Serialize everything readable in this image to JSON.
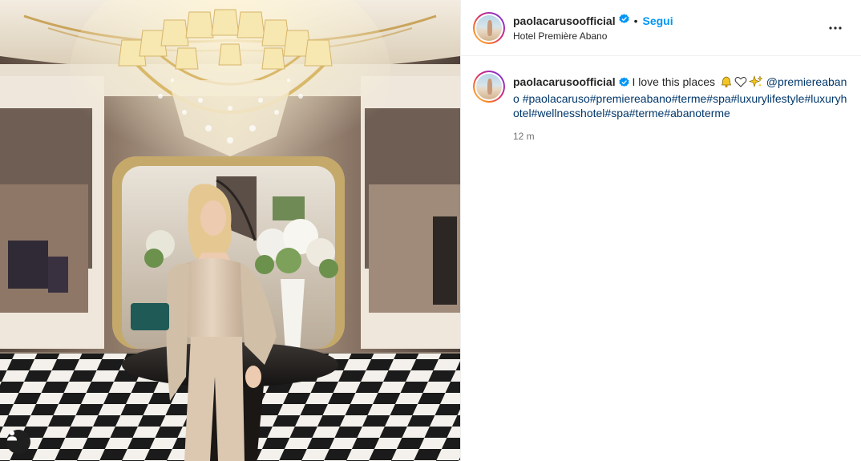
{
  "post": {
    "username": "paolacarusoofficial",
    "separator": "•",
    "follow_label": "Segui",
    "location": "Hotel Première Abano",
    "more_icon": "more-horizontal-icon"
  },
  "caption": {
    "username": "paolacarusoofficial",
    "text": "I love this places",
    "emojis": [
      "bell-emoji",
      "white-heart-emoji",
      "sparkles-emoji"
    ],
    "mention": "@premiereabano",
    "hashtags": "#paolacaruso#premiereabano#terme#spa#luxurylifestyle#luxuryhotel#wellnesshotel#spa#terme#abanoterme",
    "time": "12 m"
  },
  "colors": {
    "link_blue": "#0095f6",
    "hashtag_blue": "#00376b",
    "verified_blue": "#0095f6",
    "muted": "#737373"
  },
  "photo": {
    "description_icon": "tagged-user-icon"
  }
}
